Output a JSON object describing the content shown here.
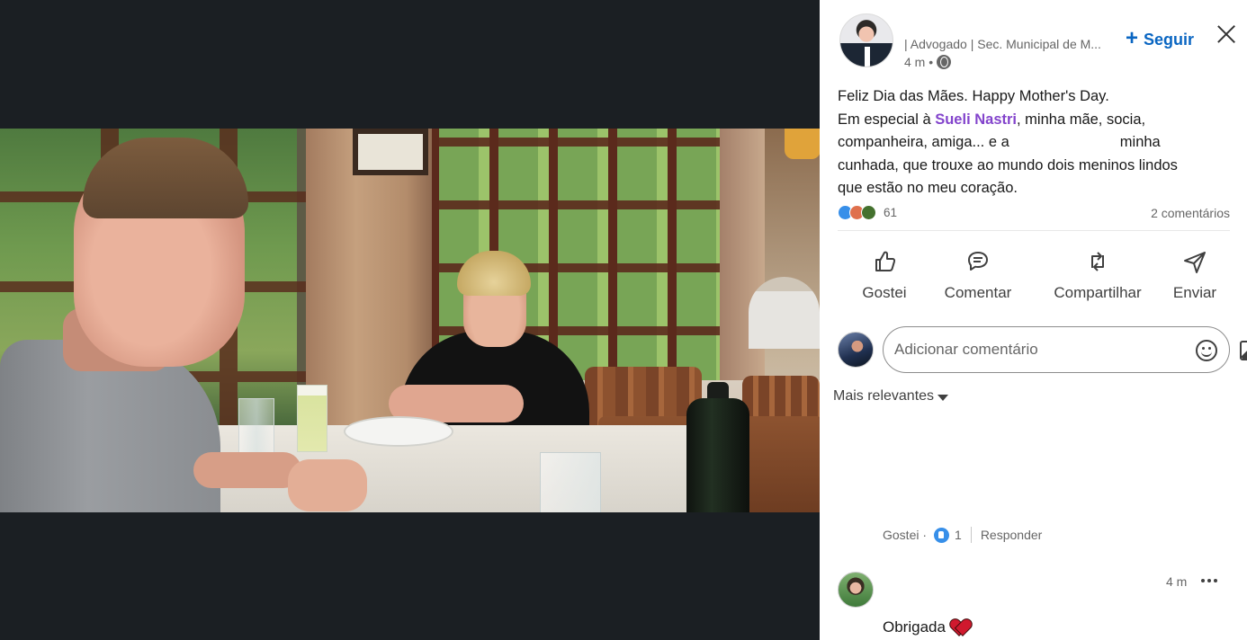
{
  "post": {
    "author_headline": "| Advogado | Sec. Municipal de M...",
    "time": "4 m •",
    "follow_label": "Seguir",
    "text": {
      "line1": "Feliz Dia das Mães. Happy Mother's Day.",
      "line2_pre": "Em especial à ",
      "mention": "Sueli Nastri",
      "line2_post": ", minha mãe, socia,",
      "line3_pre": "companheira, amiga... e a",
      "line3_post": "minha",
      "line4": "cunhada, que trouxe ao mundo dois meninos lindos",
      "line5": "que estão no meu coração."
    },
    "reaction_count": "61",
    "comments_count": "2 comentários"
  },
  "actions": [
    {
      "label": "Gostei",
      "icon": "thumbs-up-icon"
    },
    {
      "label": "Comentar",
      "icon": "comment-icon"
    },
    {
      "label": "Compartilhar",
      "icon": "repost-icon"
    },
    {
      "label": "Enviar",
      "icon": "send-icon"
    }
  ],
  "comment_box": {
    "placeholder": "Adicionar comentário"
  },
  "sort": {
    "label": "Mais relevantes"
  },
  "comments": [
    {
      "like_label": "Gostei ·",
      "like_count": "1",
      "reply_label": "Responder"
    },
    {
      "time": "4 m",
      "text": "Obrigada"
    }
  ],
  "colors": {
    "accent": "#0a66c2",
    "mention": "#8344cc",
    "viewer_bg": "#1b1f23"
  }
}
